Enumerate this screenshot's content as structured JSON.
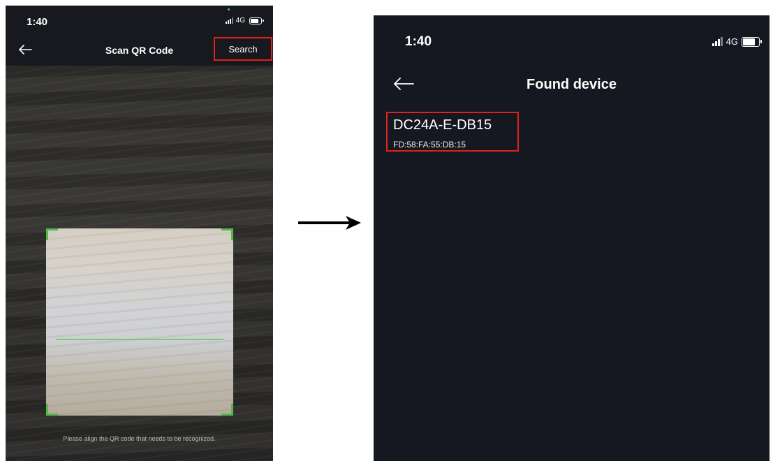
{
  "scan_screen": {
    "status_bar": {
      "time": "1:40",
      "network": "4G"
    },
    "title": "Scan QR Code",
    "search_label": "Search",
    "hint": "Please align the QR code that needs to be recognized."
  },
  "found_screen": {
    "status_bar": {
      "time": "1:40",
      "network": "4G"
    },
    "title": "Found device",
    "devices": [
      {
        "name": "DC24A-E-DB15",
        "mac": "FD:58:FA:55:DB:15"
      }
    ]
  },
  "icons": {
    "back": "arrow-left-icon",
    "signal": "signal-bars-icon",
    "battery": "battery-icon",
    "flow_arrow": "arrow-right-icon"
  },
  "colors": {
    "highlight": "#e0211c",
    "scan_accent": "#57b74d",
    "screen_bg": "#15171f"
  }
}
